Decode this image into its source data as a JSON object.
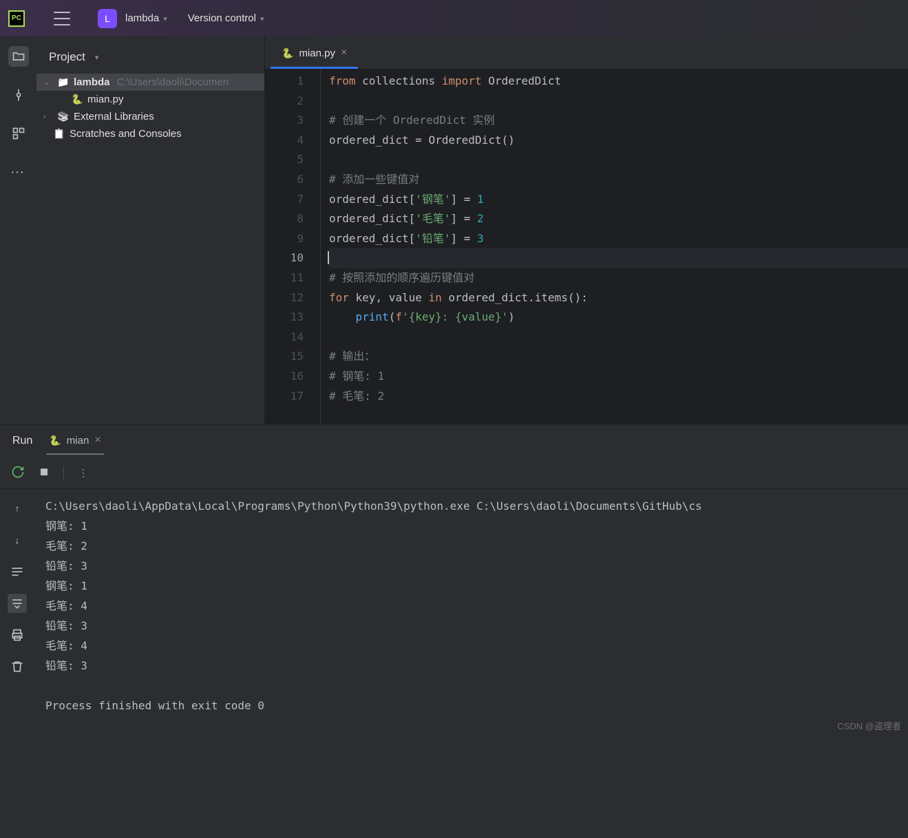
{
  "titlebar": {
    "project_badge": "L",
    "project_name": "lambda",
    "vcs_label": "Version control"
  },
  "project_panel": {
    "header": "Project",
    "root": {
      "name": "lambda",
      "path": "C:\\Users\\daoli\\Documen"
    },
    "files": [
      {
        "name": "mian.py",
        "type": "python"
      }
    ],
    "external": "External Libraries",
    "scratches": "Scratches and Consoles"
  },
  "editor": {
    "tab": {
      "name": "mian.py"
    },
    "lines": [
      {
        "n": 1,
        "tokens": [
          [
            "kw",
            "from"
          ],
          [
            "id",
            " collections "
          ],
          [
            "kw",
            "import"
          ],
          [
            "id",
            " OrderedDict"
          ]
        ]
      },
      {
        "n": 2,
        "tokens": []
      },
      {
        "n": 3,
        "tokens": [
          [
            "cmt",
            "# 创建一个 OrderedDict 实例"
          ]
        ]
      },
      {
        "n": 4,
        "tokens": [
          [
            "id",
            "ordered_dict "
          ],
          [
            "op",
            "="
          ],
          [
            "id",
            " OrderedDict"
          ],
          [
            "op",
            "()"
          ]
        ]
      },
      {
        "n": 5,
        "tokens": []
      },
      {
        "n": 6,
        "tokens": [
          [
            "cmt",
            "# 添加一些键值对"
          ]
        ]
      },
      {
        "n": 7,
        "tokens": [
          [
            "id",
            "ordered_dict"
          ],
          [
            "op",
            "["
          ],
          [
            "str",
            "'钢笔'"
          ],
          [
            "op",
            "] = "
          ],
          [
            "num",
            "1"
          ]
        ]
      },
      {
        "n": 8,
        "tokens": [
          [
            "id",
            "ordered_dict"
          ],
          [
            "op",
            "["
          ],
          [
            "str",
            "'毛笔'"
          ],
          [
            "op",
            "] = "
          ],
          [
            "num",
            "2"
          ]
        ]
      },
      {
        "n": 9,
        "tokens": [
          [
            "id",
            "ordered_dict"
          ],
          [
            "op",
            "["
          ],
          [
            "str",
            "'铅笔'"
          ],
          [
            "op",
            "] = "
          ],
          [
            "num",
            "3"
          ]
        ]
      },
      {
        "n": 10,
        "tokens": [],
        "current": true
      },
      {
        "n": 11,
        "tokens": [
          [
            "cmt",
            "# 按照添加的顺序遍历键值对"
          ]
        ]
      },
      {
        "n": 12,
        "tokens": [
          [
            "kw",
            "for"
          ],
          [
            "id",
            " key"
          ],
          [
            "op",
            ","
          ],
          [
            "id",
            " value "
          ],
          [
            "kw",
            "in"
          ],
          [
            "id",
            " ordered_dict"
          ],
          [
            "op",
            "."
          ],
          [
            "id",
            "items"
          ],
          [
            "op",
            "():"
          ]
        ]
      },
      {
        "n": 13,
        "tokens": [
          [
            "id",
            "    "
          ],
          [
            "fn",
            "print"
          ],
          [
            "op",
            "("
          ],
          [
            "kw",
            "f"
          ],
          [
            "str",
            "'{key}: {value}'"
          ],
          [
            "op",
            ")"
          ]
        ]
      },
      {
        "n": 14,
        "tokens": []
      },
      {
        "n": 15,
        "tokens": [
          [
            "cmt",
            "# 输出："
          ]
        ]
      },
      {
        "n": 16,
        "tokens": [
          [
            "cmt",
            "# 钢笔: 1"
          ]
        ]
      },
      {
        "n": 17,
        "tokens": [
          [
            "cmt",
            "# 毛笔: 2"
          ]
        ]
      }
    ]
  },
  "run_panel": {
    "title": "Run",
    "file": "mian",
    "output": "C:\\Users\\daoli\\AppData\\Local\\Programs\\Python\\Python39\\python.exe C:\\Users\\daoli\\Documents\\GitHub\\cs\n钢笔: 1\n毛笔: 2\n铅笔: 3\n钢笔: 1\n毛笔: 4\n铅笔: 3\n毛笔: 4\n铅笔: 3\n\nProcess finished with exit code 0"
  },
  "watermark": "CSDN @盗理者"
}
